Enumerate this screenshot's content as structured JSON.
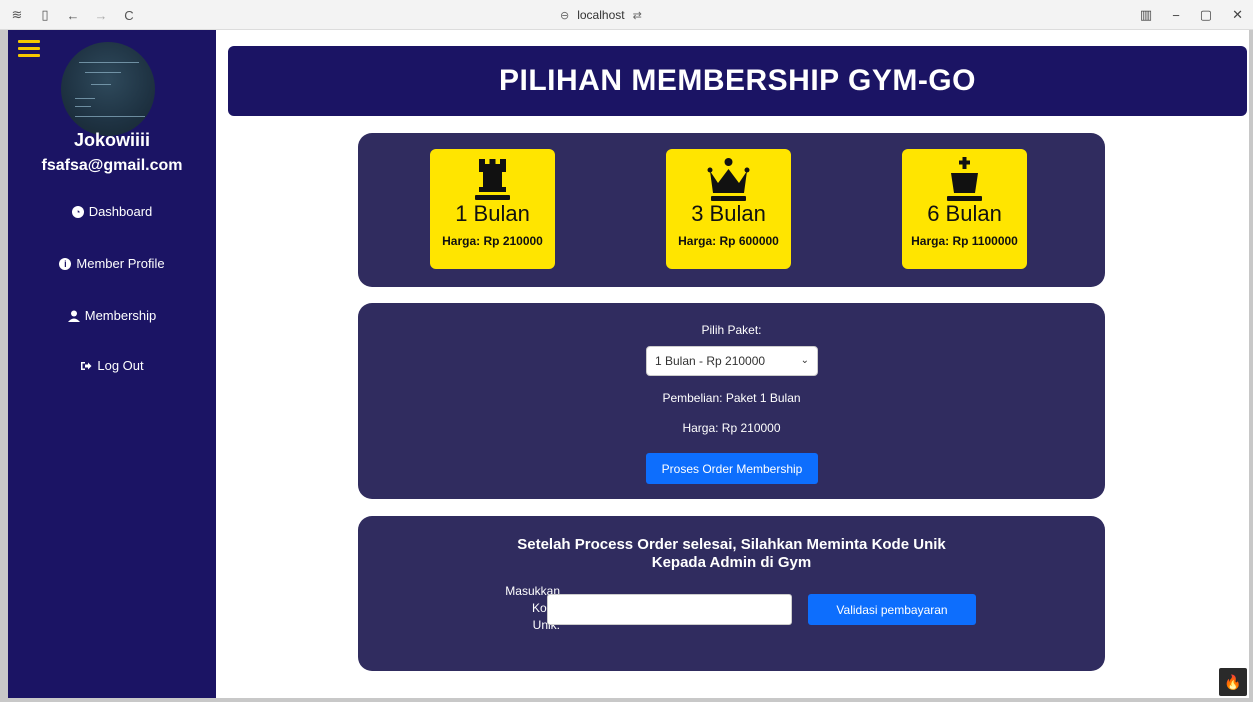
{
  "browser": {
    "address": "localhost",
    "back_glyph": "←",
    "forward_glyph": "→",
    "reload_glyph": "C",
    "minimize_glyph": "−",
    "restore_glyph": "▢",
    "close_glyph": "✕"
  },
  "sidebar": {
    "user_name": "Jokowiiii",
    "user_email": "fsafsa@gmail.com",
    "menu": [
      {
        "label": "Dashboard",
        "icon": "tachometer-icon"
      },
      {
        "label": "Member Profile",
        "icon": "info-circle-icon"
      },
      {
        "label": "Membership",
        "icon": "user-icon"
      },
      {
        "label": "Log Out",
        "icon": "sign-out-icon"
      }
    ]
  },
  "main": {
    "title": "PILIHAN MEMBERSHIP GYM-GO",
    "packages": [
      {
        "duration": "1 Bulan",
        "price": "Harga: Rp 210000",
        "icon": "chess-rook-icon"
      },
      {
        "duration": "3 Bulan",
        "price": "Harga: Rp 600000",
        "icon": "chess-queen-icon"
      },
      {
        "duration": "6 Bulan",
        "price": "Harga: Rp 1100000",
        "icon": "chess-king-icon"
      }
    ],
    "order": {
      "select_label": "Pilih Paket:",
      "selected_option": "1 Bulan - Rp 210000",
      "purchase_text": "Pembelian: Paket 1 Bulan",
      "price_text": "Harga: Rp 210000",
      "submit_label": "Proses Order Membership"
    },
    "validation": {
      "title_line1": "Setelah Process Order selesai, Silahkan Meminta Kode Unik",
      "title_line2": "Kepada Admin di Gym",
      "code_label_1": "Masukkan",
      "code_label_2": "Kode",
      "code_label_3": "Unik:",
      "code_value": "",
      "submit_label": "Validasi pembayaran"
    }
  },
  "colors": {
    "sidebar_bg": "#1b1464",
    "panel_bg": "#302c5f",
    "card_bg": "#ffe500",
    "button_blue": "#0d6efd",
    "hamburger": "#f5c800"
  }
}
